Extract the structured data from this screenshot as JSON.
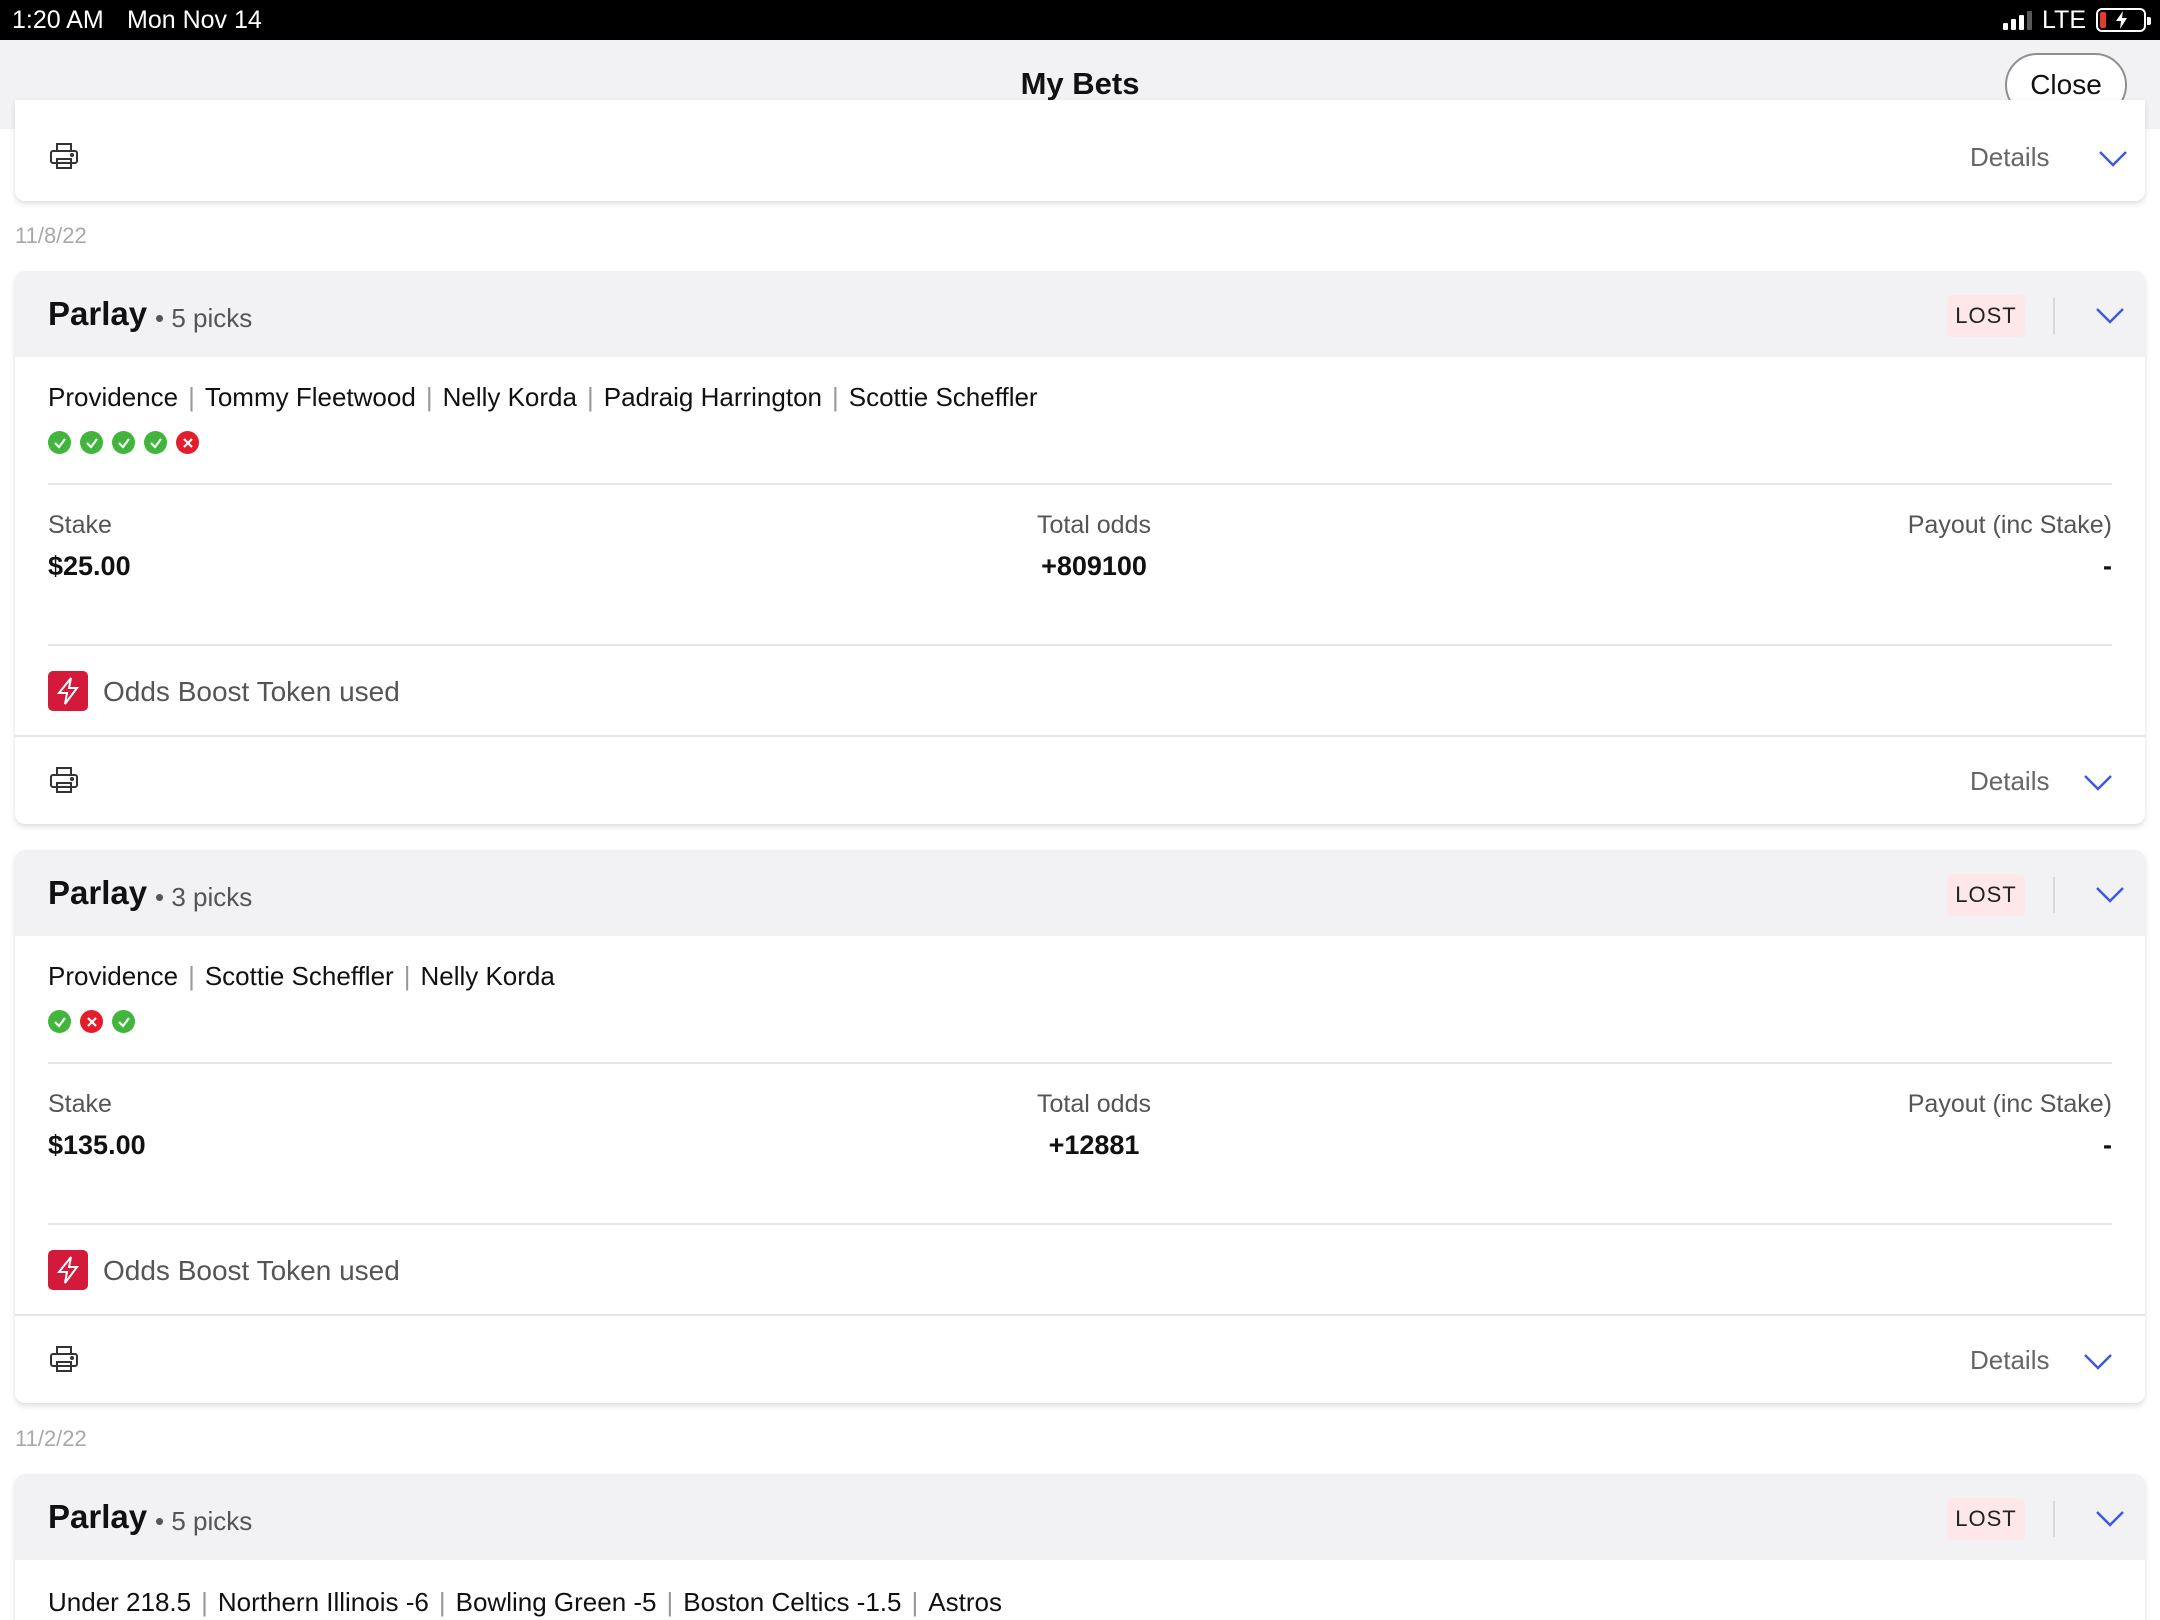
{
  "status_bar": {
    "time": "1:20 AM",
    "date": "Mon Nov 14",
    "network": "LTE"
  },
  "header": {
    "title": "My Bets",
    "close_label": "Close"
  },
  "top_card": {
    "details_label": "Details"
  },
  "date_groups": [
    "11/8/22",
    "11/2/22"
  ],
  "bets": [
    {
      "type": "Parlay",
      "picks_label": "• 5 picks",
      "status": "LOST",
      "legs": [
        "Providence",
        "Tommy Fleetwood",
        "Nelly Korda",
        "Padraig Harrington",
        "Scottie Scheffler"
      ],
      "results": [
        "win",
        "win",
        "win",
        "win",
        "loss"
      ],
      "stake_label": "Stake",
      "stake": "$25.00",
      "odds_label": "Total odds",
      "odds": "+809100",
      "payout_label": "Payout (inc Stake)",
      "payout": "-",
      "boost_label": "Odds Boost Token used",
      "details_label": "Details"
    },
    {
      "type": "Parlay",
      "picks_label": "• 3 picks",
      "status": "LOST",
      "legs": [
        "Providence",
        "Scottie Scheffler",
        "Nelly Korda"
      ],
      "results": [
        "win",
        "loss",
        "win"
      ],
      "stake_label": "Stake",
      "stake": "$135.00",
      "odds_label": "Total odds",
      "odds": "+12881",
      "payout_label": "Payout (inc Stake)",
      "payout": "-",
      "boost_label": "Odds Boost Token used",
      "details_label": "Details"
    },
    {
      "type": "Parlay",
      "picks_label": "• 5 picks",
      "status": "LOST",
      "legs": [
        "Under 218.5",
        "Northern Illinois -6",
        "Bowling Green -5",
        "Boston Celtics -1.5",
        "Astros"
      ]
    }
  ],
  "colors": {
    "win": "#41b53c",
    "loss": "#e31d2c",
    "accent": "#3d5bd9",
    "lost_badge_bg": "#fde7e8",
    "boost": "#d31a3a",
    "header_bg": "#f2f2f4"
  },
  "icons": [
    "printer-icon",
    "chevron-down-icon",
    "lightning-bolt-icon",
    "check-icon",
    "x-icon",
    "signal-icon",
    "battery-charging-icon"
  ]
}
